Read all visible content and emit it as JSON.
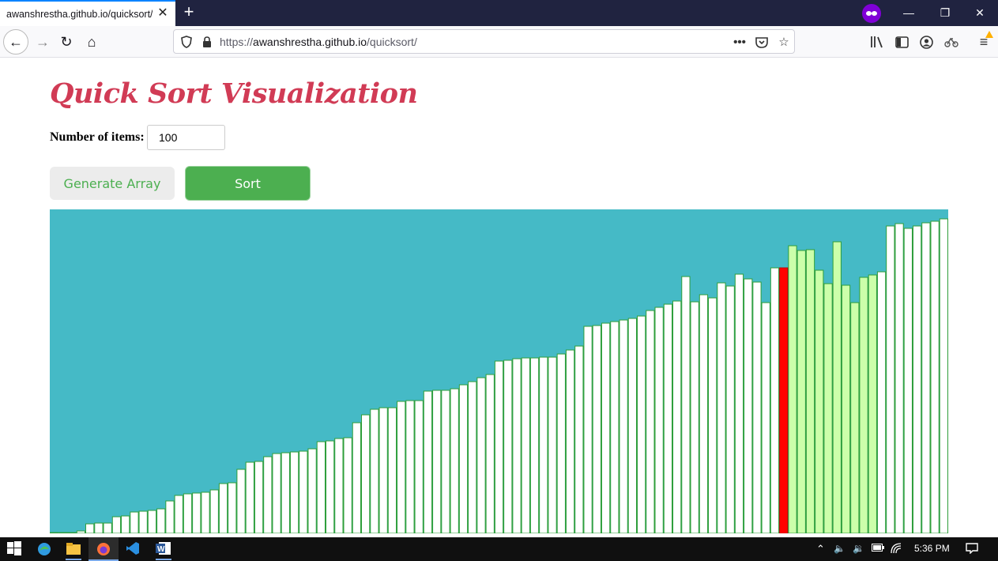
{
  "browser": {
    "tab_title": "awanshrestha.github.io/quicksort/",
    "url_prefix": "https://",
    "url_host": "awanshrestha.github.io",
    "url_path": "/quicksort/"
  },
  "page": {
    "title": "Quick Sort Visualization",
    "items_label": "Number of items:",
    "items_value": "100",
    "generate_label": "Generate Array",
    "sort_label": "Sort"
  },
  "visualization": {
    "background": "#45bac6",
    "bar_fill": "#ffffff",
    "bar_stroke": "#2e9e3a",
    "pivot_fill": "#ff0000",
    "partition_fill": "#ccffaa",
    "pivot_index": 82,
    "partition_range": [
      83,
      92
    ],
    "heights": [
      1,
      1,
      1,
      3,
      12,
      13,
      13,
      21,
      22,
      27,
      28,
      29,
      31,
      41,
      48,
      50,
      51,
      52,
      55,
      63,
      64,
      81,
      90,
      91,
      97,
      101,
      102,
      103,
      104,
      107,
      116,
      117,
      120,
      121,
      140,
      150,
      157,
      159,
      159,
      167,
      168,
      168,
      180,
      181,
      181,
      183,
      188,
      192,
      197,
      201,
      218,
      219,
      221,
      222,
      222,
      223,
      223,
      227,
      232,
      237,
      262,
      263,
      266,
      268,
      270,
      272,
      275,
      282,
      286,
      290,
      294,
      325,
      293,
      302,
      298,
      317,
      313,
      328,
      322,
      318,
      292,
      336,
      336,
      364,
      358,
      359,
      333,
      316,
      369,
      314,
      292,
      324,
      327,
      331,
      389,
      392,
      386,
      389,
      393,
      395,
      398
    ]
  },
  "taskbar": {
    "time": "5:36 PM"
  }
}
